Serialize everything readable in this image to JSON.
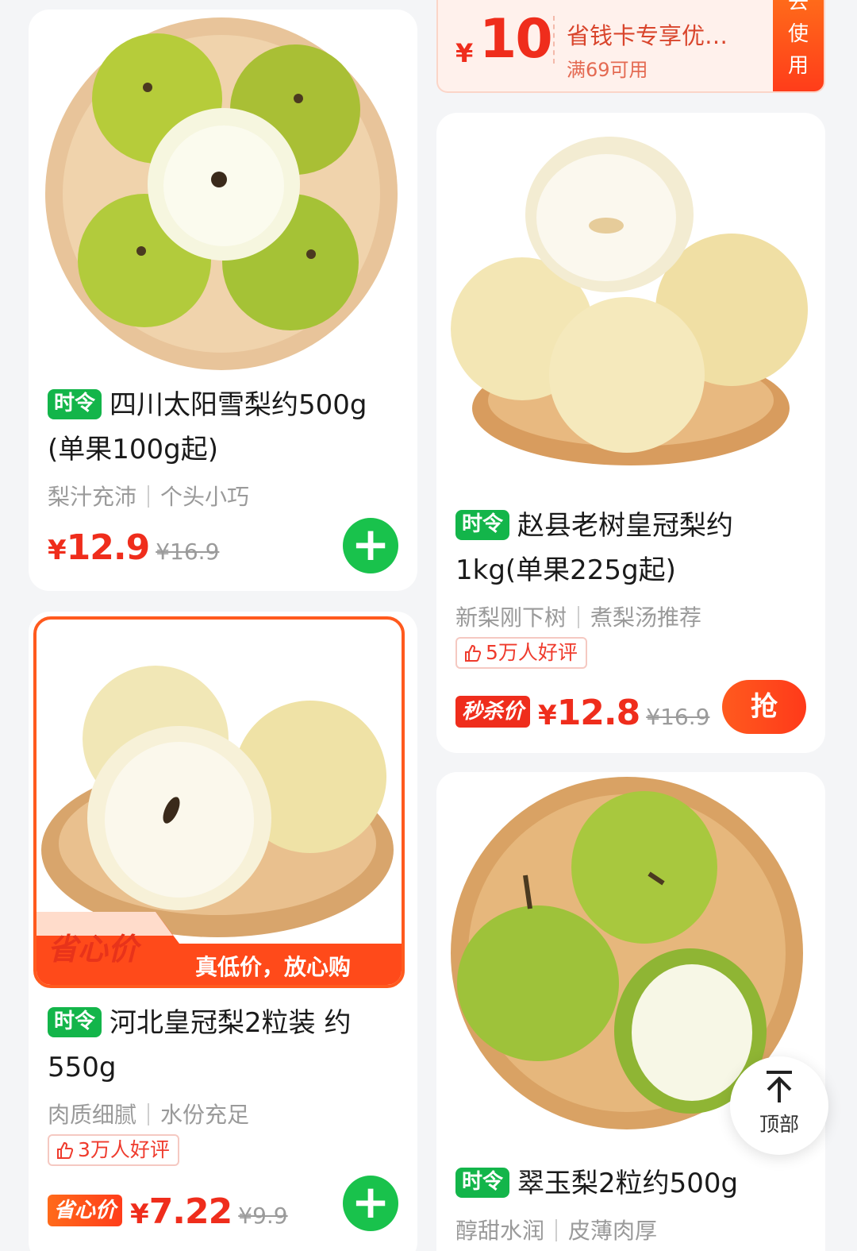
{
  "coupon": {
    "yen": "¥",
    "amount": "10",
    "title": "省钱卡专享优…",
    "condition": "满69可用",
    "use_label": [
      "去",
      "使",
      "用"
    ]
  },
  "products": [
    {
      "tag": "时令",
      "title": "四川太阳雪梨约500g (单果100g起)",
      "features": [
        "梨汁充沛",
        "个头小巧"
      ],
      "price_yen": "¥",
      "price": "12.9",
      "old_price": "¥16.9",
      "action": "add-button"
    },
    {
      "tag": "时令",
      "title": "赵县老树皇冠梨约1kg(单果225g起)",
      "features": [
        "新梨刚下树",
        "煮梨汤推荐"
      ],
      "rating": "5万人好评",
      "price_badge": "秒杀价",
      "price_yen": "¥",
      "price": "12.8",
      "old_price": "¥16.9",
      "action_label": "抢"
    },
    {
      "promo_banner": {
        "left": "省心价",
        "right": "真低价，放心购"
      },
      "tag": "时令",
      "title": "河北皇冠梨2粒装 约550g",
      "features": [
        "肉质细腻",
        "水份充足"
      ],
      "rating": "3万人好评",
      "price_badge": "省心价",
      "price_yen": "¥",
      "price": "7.22",
      "old_price": "¥9.9",
      "action": "add-button"
    },
    {
      "tag": "时令",
      "title": "翠玉梨2粒约500g",
      "features": [
        "醇甜水润",
        "皮薄肉厚"
      ]
    }
  ],
  "back_to_top": {
    "label": "顶部"
  },
  "colors": {
    "accent_red": "#ef2d1c",
    "tag_green": "#13b54a",
    "add_green": "#19c24c",
    "promo_orange": "#ff5a1e"
  },
  "icons": [
    "plus-icon",
    "thumbs-up-icon",
    "arrow-up-icon"
  ]
}
